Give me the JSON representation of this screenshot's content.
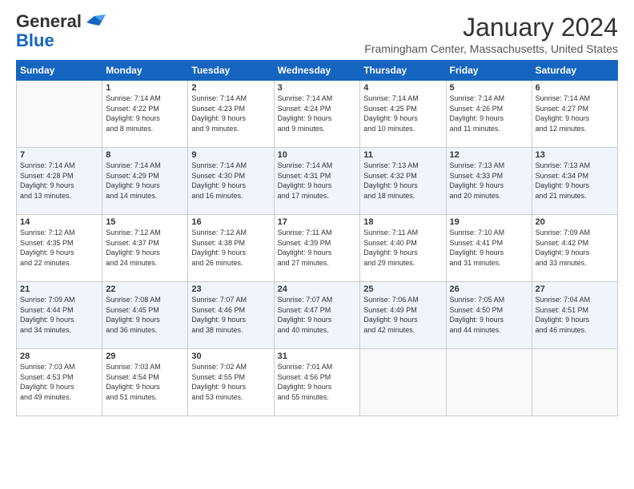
{
  "logo": {
    "general": "General",
    "blue": "Blue"
  },
  "title": "January 2024",
  "location": "Framingham Center, Massachusetts, United States",
  "days_header": [
    "Sunday",
    "Monday",
    "Tuesday",
    "Wednesday",
    "Thursday",
    "Friday",
    "Saturday"
  ],
  "weeks": [
    [
      {
        "day": "",
        "info": ""
      },
      {
        "day": "1",
        "info": "Sunrise: 7:14 AM\nSunset: 4:22 PM\nDaylight: 9 hours\nand 8 minutes."
      },
      {
        "day": "2",
        "info": "Sunrise: 7:14 AM\nSunset: 4:23 PM\nDaylight: 9 hours\nand 9 minutes."
      },
      {
        "day": "3",
        "info": "Sunrise: 7:14 AM\nSunset: 4:24 PM\nDaylight: 9 hours\nand 9 minutes."
      },
      {
        "day": "4",
        "info": "Sunrise: 7:14 AM\nSunset: 4:25 PM\nDaylight: 9 hours\nand 10 minutes."
      },
      {
        "day": "5",
        "info": "Sunrise: 7:14 AM\nSunset: 4:26 PM\nDaylight: 9 hours\nand 11 minutes."
      },
      {
        "day": "6",
        "info": "Sunrise: 7:14 AM\nSunset: 4:27 PM\nDaylight: 9 hours\nand 12 minutes."
      }
    ],
    [
      {
        "day": "7",
        "info": "Sunrise: 7:14 AM\nSunset: 4:28 PM\nDaylight: 9 hours\nand 13 minutes."
      },
      {
        "day": "8",
        "info": "Sunrise: 7:14 AM\nSunset: 4:29 PM\nDaylight: 9 hours\nand 14 minutes."
      },
      {
        "day": "9",
        "info": "Sunrise: 7:14 AM\nSunset: 4:30 PM\nDaylight: 9 hours\nand 16 minutes."
      },
      {
        "day": "10",
        "info": "Sunrise: 7:14 AM\nSunset: 4:31 PM\nDaylight: 9 hours\nand 17 minutes."
      },
      {
        "day": "11",
        "info": "Sunrise: 7:13 AM\nSunset: 4:32 PM\nDaylight: 9 hours\nand 18 minutes."
      },
      {
        "day": "12",
        "info": "Sunrise: 7:13 AM\nSunset: 4:33 PM\nDaylight: 9 hours\nand 20 minutes."
      },
      {
        "day": "13",
        "info": "Sunrise: 7:13 AM\nSunset: 4:34 PM\nDaylight: 9 hours\nand 21 minutes."
      }
    ],
    [
      {
        "day": "14",
        "info": "Sunrise: 7:12 AM\nSunset: 4:35 PM\nDaylight: 9 hours\nand 22 minutes."
      },
      {
        "day": "15",
        "info": "Sunrise: 7:12 AM\nSunset: 4:37 PM\nDaylight: 9 hours\nand 24 minutes."
      },
      {
        "day": "16",
        "info": "Sunrise: 7:12 AM\nSunset: 4:38 PM\nDaylight: 9 hours\nand 26 minutes."
      },
      {
        "day": "17",
        "info": "Sunrise: 7:11 AM\nSunset: 4:39 PM\nDaylight: 9 hours\nand 27 minutes."
      },
      {
        "day": "18",
        "info": "Sunrise: 7:11 AM\nSunset: 4:40 PM\nDaylight: 9 hours\nand 29 minutes."
      },
      {
        "day": "19",
        "info": "Sunrise: 7:10 AM\nSunset: 4:41 PM\nDaylight: 9 hours\nand 31 minutes."
      },
      {
        "day": "20",
        "info": "Sunrise: 7:09 AM\nSunset: 4:42 PM\nDaylight: 9 hours\nand 33 minutes."
      }
    ],
    [
      {
        "day": "21",
        "info": "Sunrise: 7:09 AM\nSunset: 4:44 PM\nDaylight: 9 hours\nand 34 minutes."
      },
      {
        "day": "22",
        "info": "Sunrise: 7:08 AM\nSunset: 4:45 PM\nDaylight: 9 hours\nand 36 minutes."
      },
      {
        "day": "23",
        "info": "Sunrise: 7:07 AM\nSunset: 4:46 PM\nDaylight: 9 hours\nand 38 minutes."
      },
      {
        "day": "24",
        "info": "Sunrise: 7:07 AM\nSunset: 4:47 PM\nDaylight: 9 hours\nand 40 minutes."
      },
      {
        "day": "25",
        "info": "Sunrise: 7:06 AM\nSunset: 4:49 PM\nDaylight: 9 hours\nand 42 minutes."
      },
      {
        "day": "26",
        "info": "Sunrise: 7:05 AM\nSunset: 4:50 PM\nDaylight: 9 hours\nand 44 minutes."
      },
      {
        "day": "27",
        "info": "Sunrise: 7:04 AM\nSunset: 4:51 PM\nDaylight: 9 hours\nand 46 minutes."
      }
    ],
    [
      {
        "day": "28",
        "info": "Sunrise: 7:03 AM\nSunset: 4:53 PM\nDaylight: 9 hours\nand 49 minutes."
      },
      {
        "day": "29",
        "info": "Sunrise: 7:03 AM\nSunset: 4:54 PM\nDaylight: 9 hours\nand 51 minutes."
      },
      {
        "day": "30",
        "info": "Sunrise: 7:02 AM\nSunset: 4:55 PM\nDaylight: 9 hours\nand 53 minutes."
      },
      {
        "day": "31",
        "info": "Sunrise: 7:01 AM\nSunset: 4:56 PM\nDaylight: 9 hours\nand 55 minutes."
      },
      {
        "day": "",
        "info": ""
      },
      {
        "day": "",
        "info": ""
      },
      {
        "day": "",
        "info": ""
      }
    ]
  ]
}
